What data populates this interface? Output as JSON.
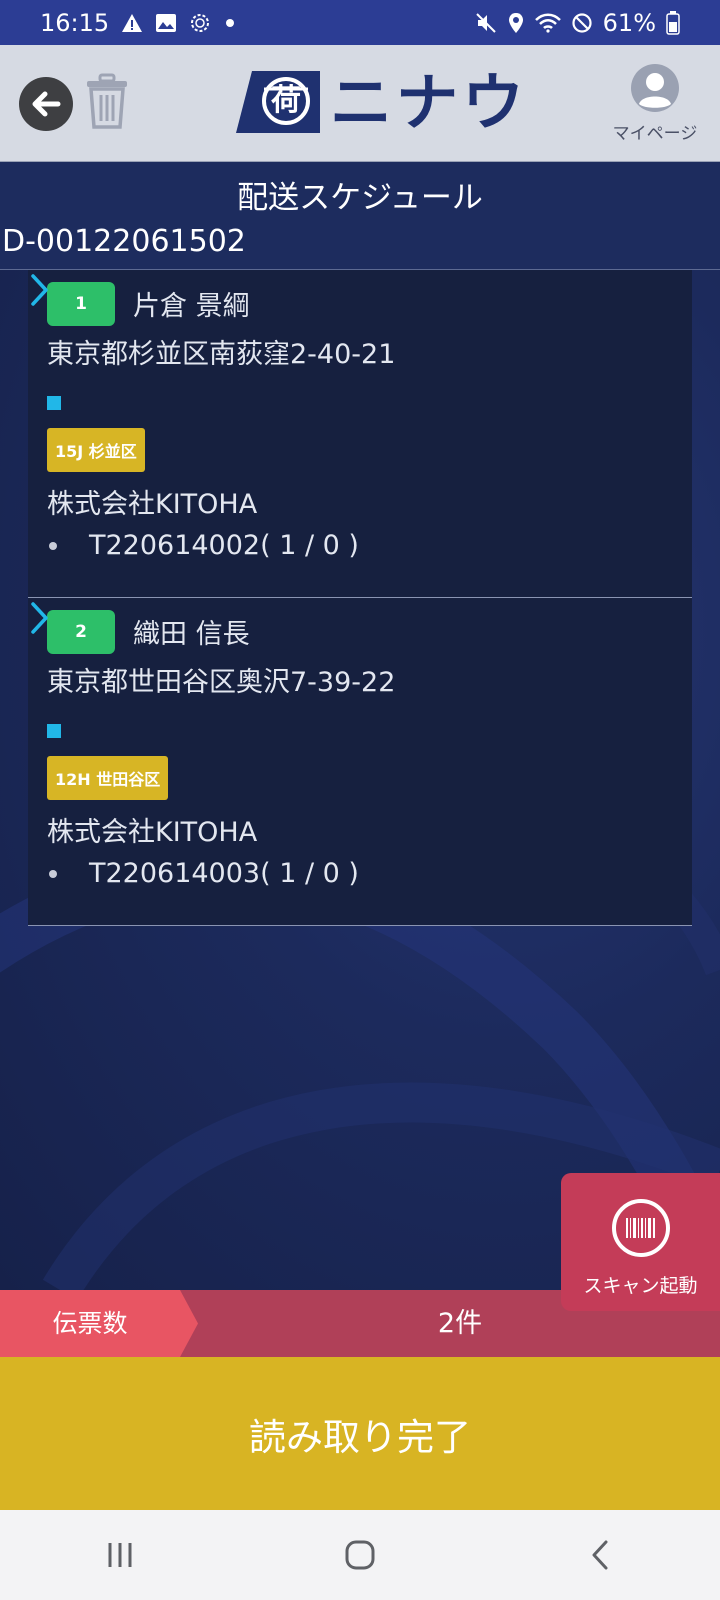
{
  "status_bar": {
    "time": "16:15",
    "battery": "61%",
    "notification_icons": [
      "warning-icon",
      "image-icon",
      "sync-icon",
      "dot-icon"
    ],
    "system_icons": [
      "mute-icon",
      "location-icon",
      "wifi-icon",
      "dnd-icon",
      "battery-icon"
    ]
  },
  "header": {
    "logo_text": "ニナウ",
    "logo_emblem": "荷",
    "mypage_label": "マイページ"
  },
  "title_band": {
    "title": "配送スケジュール",
    "delivery_id": "D-00122061502"
  },
  "deliveries": [
    {
      "seq": "1",
      "recipient": "片倉 景綱",
      "address": "東京都杉並区南荻窪2-40-21",
      "area_tag": "15J 杉並区",
      "company": "株式会社KITOHA",
      "tracking": "T220614002( 1 / 0 )"
    },
    {
      "seq": "2",
      "recipient": "織田 信長",
      "address": "東京都世田谷区奥沢7-39-22",
      "area_tag": "12H 世田谷区",
      "company": "株式会社KITOHA",
      "tracking": "T220614003( 1 / 0 )"
    }
  ],
  "scan_fab": {
    "label": "スキャン起動"
  },
  "count_bar": {
    "label": "伝票数",
    "value": "2件"
  },
  "complete_button": {
    "label": "読み取り完了"
  },
  "colors": {
    "status_bar": "#2c3d94",
    "header_bg": "#d6dae3",
    "title_band": "#1d2c5e",
    "badge_green": "#2dbf69",
    "area_tag_yellow": "#d7b525",
    "chevron_cyan": "#21b7e8",
    "scan_red": "#c43c58",
    "count_bar": "#b04058",
    "count_label": "#e85563",
    "complete_yellow": "#d8b423"
  }
}
